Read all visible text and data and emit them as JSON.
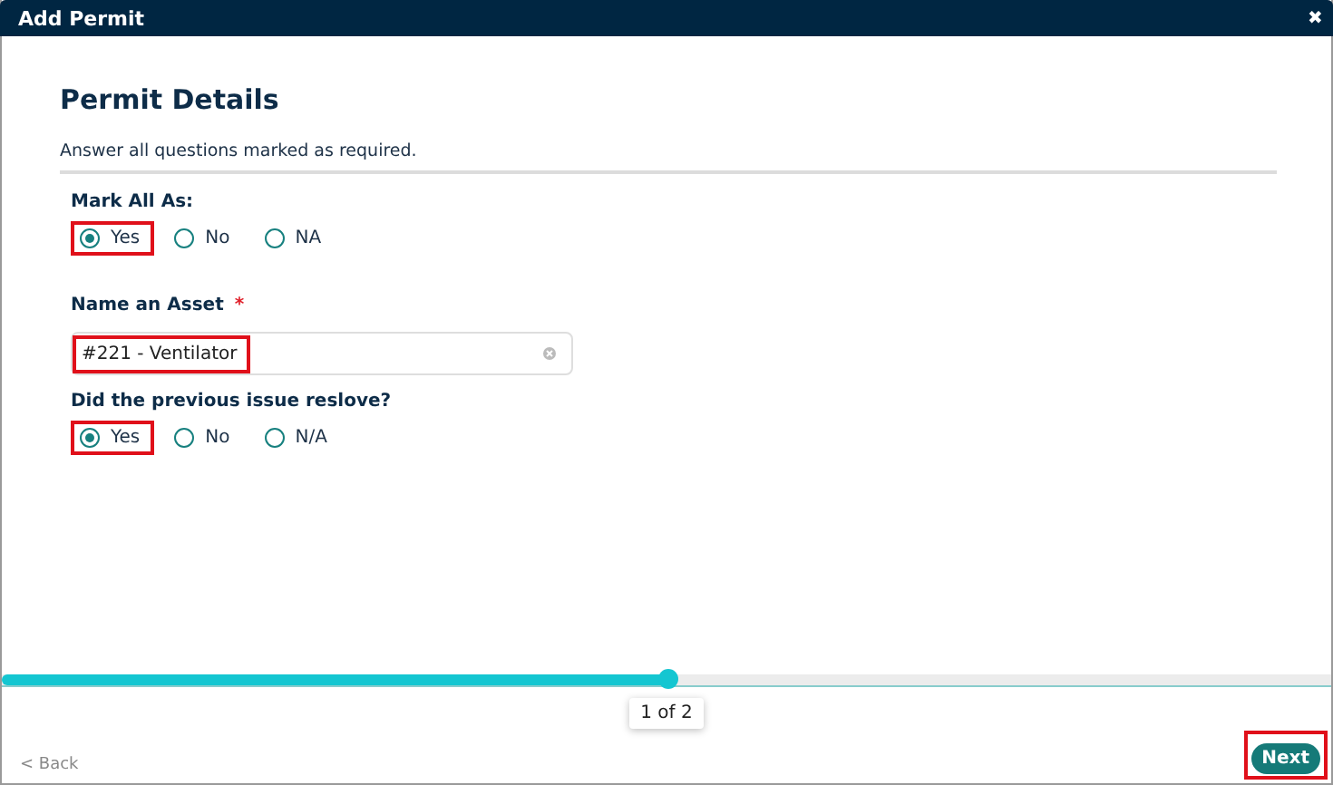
{
  "window": {
    "title": "Add Permit",
    "close": "✖"
  },
  "heading": "Permit Details",
  "instructions": "Answer all questions marked as required.",
  "questions": [
    {
      "kind": "radio",
      "label": "Mark All As:",
      "options": [
        {
          "label": "Yes",
          "selected": true,
          "highlighted": true
        },
        {
          "label": "No",
          "selected": false,
          "highlighted": false
        },
        {
          "label": "NA",
          "selected": false,
          "highlighted": false
        }
      ]
    },
    {
      "kind": "text",
      "label": "Name an Asset",
      "required": true,
      "required_mark": "*",
      "value": "#221 - Ventilator",
      "highlighted": true
    },
    {
      "kind": "radio",
      "label": "Did the previous issue reslove?",
      "options": [
        {
          "label": "Yes",
          "selected": true,
          "highlighted": true
        },
        {
          "label": "No",
          "selected": false,
          "highlighted": false
        },
        {
          "label": "N/A",
          "selected": false,
          "highlighted": false
        }
      ]
    }
  ],
  "progress": {
    "level": 0.5,
    "label": "1 of 2"
  },
  "footer": {
    "back": "< Back",
    "next": {
      "label": "Next",
      "highlighted": true
    }
  }
}
